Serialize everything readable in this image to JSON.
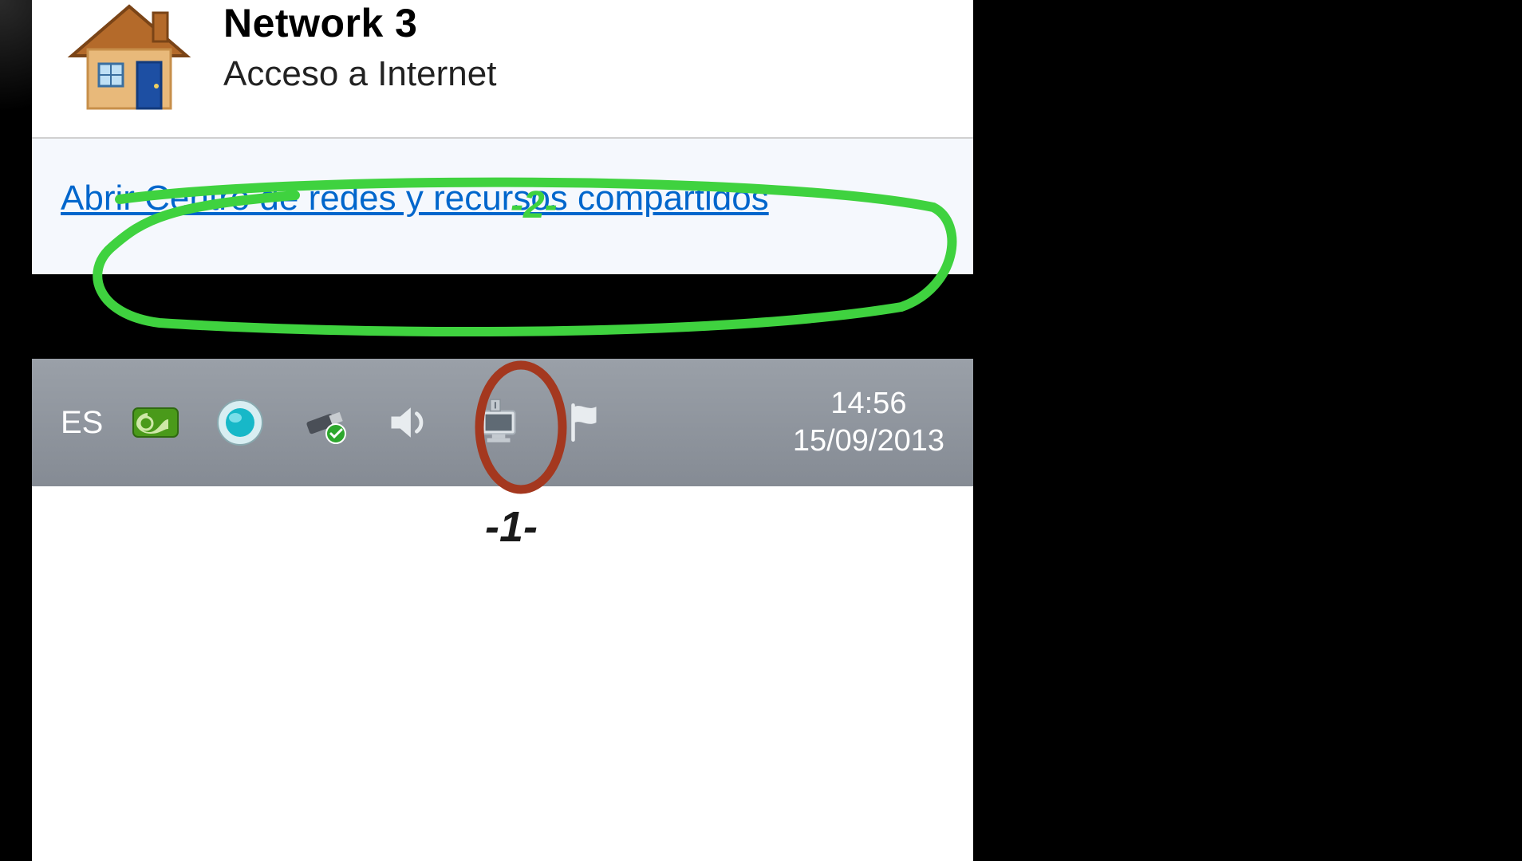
{
  "popup": {
    "icon": "house-home-network-icon",
    "network_name": "Network  3",
    "status": "Acceso a Internet",
    "link_label": "Abrir Centro de redes y recursos compartidos"
  },
  "taskbar": {
    "lang": "ES",
    "tray": [
      {
        "name": "nvidia-icon"
      },
      {
        "name": "media-orb-icon"
      },
      {
        "name": "safely-remove-hardware-icon"
      },
      {
        "name": "volume-icon"
      },
      {
        "name": "network-connection-icon"
      },
      {
        "name": "action-center-flag-icon"
      }
    ],
    "clock_time": "14:56",
    "clock_date": "15/09/2013"
  },
  "annotations": {
    "step1": "-1-",
    "step2": "-2-",
    "colors": {
      "step1": "#a4381f",
      "step2": "#3fd23f"
    }
  }
}
